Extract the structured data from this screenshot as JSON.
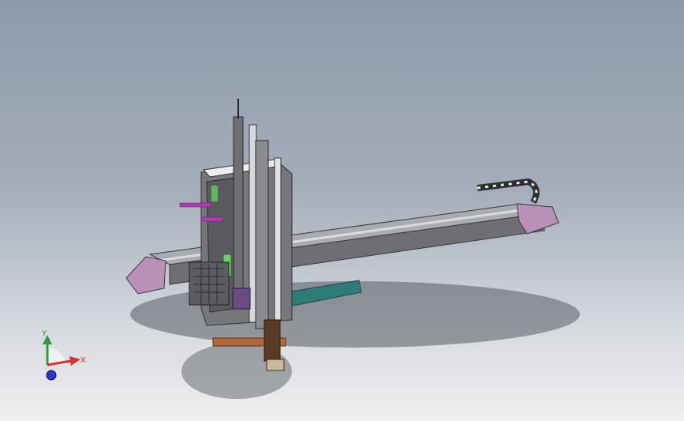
{
  "viewport": {
    "background_top": "#8e9aab",
    "background_bottom": "#eeeff0"
  },
  "model": {
    "description_name": "gantry-robot-assembly",
    "colors": {
      "body": "#6f6f73",
      "body_dark": "#4e4e52",
      "end_cap": "#b990b7",
      "teal": "#2f7b77",
      "green": "#6fd26a",
      "magenta": "#b03cb3",
      "copper": "#b06a3a",
      "brown": "#5b3a25",
      "rail": "#d9dcdf"
    }
  },
  "triad": {
    "x_label": "X",
    "y_label": "Y",
    "x_color": "#d6332a",
    "y_color": "#2f9a3a",
    "z_color": "#2b36c9"
  }
}
